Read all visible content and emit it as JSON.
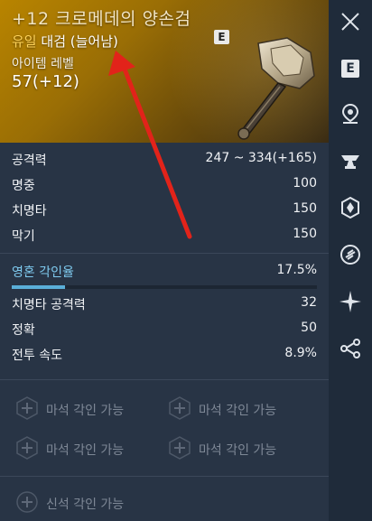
{
  "item": {
    "title": "+12 크로메데의 양손검",
    "grade": "유일",
    "type": "대검 (늘어남)",
    "badge": "E",
    "level_label": "아이템 레벨",
    "level_value": "57(+12)"
  },
  "stats": [
    {
      "name": "공격력",
      "value": "247 ~ 334(+165)"
    },
    {
      "name": "명중",
      "value": "100"
    },
    {
      "name": "치명타",
      "value": "150"
    },
    {
      "name": "막기",
      "value": "150"
    }
  ],
  "soul": {
    "name": "영혼 각인율",
    "value": "17.5%",
    "fill_fraction": 0.175
  },
  "soul_stats": [
    {
      "name": "치명타 공격력",
      "value": "32"
    },
    {
      "name": "정확",
      "value": "50"
    },
    {
      "name": "전투 속도",
      "value": "8.9%"
    }
  ],
  "gems": {
    "manastone": [
      "마석 각인 가능",
      "마석 각인 가능",
      "마석 각인 가능",
      "마석 각인 가능"
    ],
    "divine": "신석 각인 가능"
  },
  "sidebar": {
    "icons": [
      "close-icon",
      "e-icon",
      "location-pin-icon",
      "anvil-icon",
      "crystal-icon",
      "link-icon",
      "star-burst-icon",
      "share-icon"
    ],
    "e_label": "E"
  },
  "colors": {
    "header_gold": "#b88400",
    "grade_yellow": "#ffd35a",
    "soul_blue": "#7fcbf0",
    "arrow_red": "#e2231a"
  }
}
